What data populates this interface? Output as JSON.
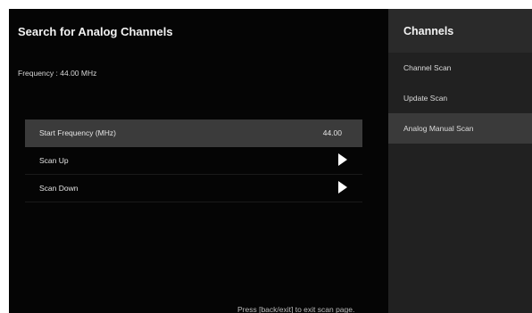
{
  "main": {
    "title": "Search for Analog Channels",
    "frequency_label": "Frequency :",
    "frequency_value": "44.00 MHz",
    "rows": [
      {
        "label": "Start Frequency (MHz)",
        "value": "44.00"
      },
      {
        "label": "Scan Up",
        "icon": "play-arrow-icon"
      },
      {
        "label": "Scan Down",
        "icon": "play-arrow-icon"
      }
    ],
    "hint": "Press [back/exit] to exit scan page."
  },
  "side": {
    "title": "Channels",
    "items": [
      {
        "label": "Channel Scan"
      },
      {
        "label": "Update Scan"
      },
      {
        "label": "Analog Manual Scan"
      }
    ],
    "active_index": 2
  },
  "colors": {
    "background": "#050505",
    "selected_row": "#3b3b3b",
    "side_panel": "#212121",
    "side_active": "#3a3a3a",
    "text": "#e4e4e4"
  }
}
